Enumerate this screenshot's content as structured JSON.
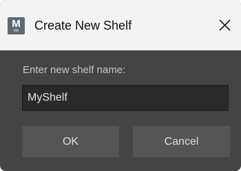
{
  "window": {
    "title": "Create New Shelf",
    "app_icon": {
      "name": "maya-app-icon",
      "glyph": "M",
      "sub": "MA"
    },
    "close_icon": "close-icon"
  },
  "form": {
    "prompt": "Enter new shelf name:",
    "input_value": "MyShelf"
  },
  "buttons": {
    "ok_label": "OK",
    "cancel_label": "Cancel"
  },
  "colors": {
    "titlebar": "#f3f3f3",
    "body": "#444444",
    "input_bg": "#2a2a2a",
    "button_bg": "#555555",
    "label_text": "#c6c6c6"
  }
}
